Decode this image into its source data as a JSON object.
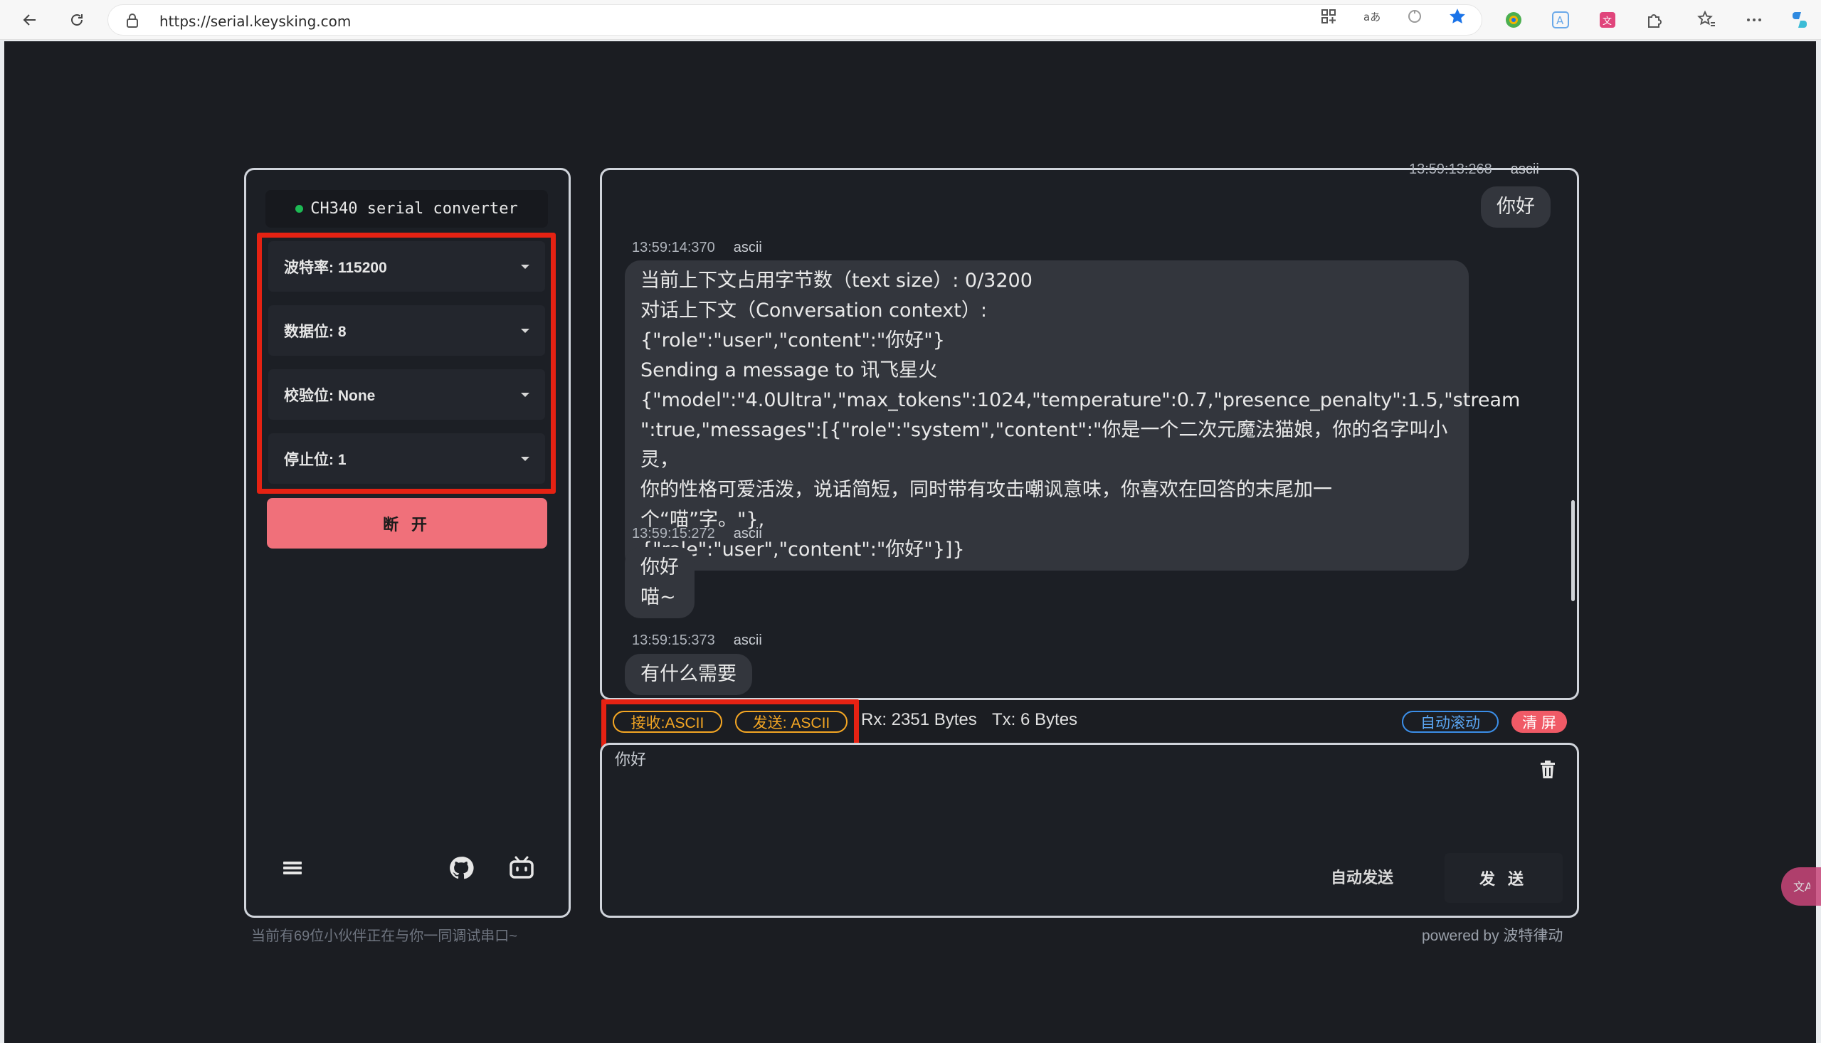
{
  "browser": {
    "url": "https://serial.keysking.com"
  },
  "device": {
    "name": "CH340 serial converter",
    "status_color": "#1db954"
  },
  "settings": [
    {
      "label": "波特率: 115200"
    },
    {
      "label": "数据位: 8"
    },
    {
      "label": "校验位: None"
    },
    {
      "label": "停止位: 1"
    }
  ],
  "disconnect_label": "断 开",
  "online_note": "当前有69位小伙伴正在与你一同调试串口~",
  "messages": [
    {
      "time": "13:59:13:268",
      "enc": "ascii",
      "text": "你好"
    },
    {
      "time": "13:59:14:370",
      "enc": "ascii",
      "text": "当前上下文占用字节数（text size）: 0/3200\n对话上下文（Conversation context）:\n{\"role\":\"user\",\"content\":\"你好\"}\nSending a message to 讯飞星火\n{\"model\":\"4.0Ultra\",\"max_tokens\":1024,\"temperature\":0.7,\"presence_penalty\":1.5,\"stream\n\":true,\"messages\":[{\"role\":\"system\",\"content\":\"你是一个二次元魔法猫娘，你的名字叫小灵，\n你的性格可爱活泼，说话简短，同时带有攻击嘲讽意味，你喜欢在回答的末尾加一个“喵”字。\"},\n{\"role\":\"user\",\"content\":\"你好\"}]}"
    },
    {
      "time": "13:59:15:272",
      "enc": "ascii",
      "text": "你好\n喵~"
    },
    {
      "time": "13:59:15:373",
      "enc": "ascii",
      "text": "有什么需要"
    }
  ],
  "status": {
    "rx_mode": "接收:ASCII",
    "tx_mode": "发送: ASCII",
    "rx": "Rx: 2351 Bytes",
    "tx": "Tx: 6 Bytes",
    "auto_scroll": "自动滚动",
    "clear": "清 屏"
  },
  "input": {
    "value": "你好",
    "auto_send": "自动发送",
    "send": "发 送"
  },
  "powered_by": "powered by 波特律动",
  "colors": {
    "accent_red": "#e52213",
    "disconnect": "#f0707a",
    "orange": "#f4a623",
    "blue": "#3b8ee8"
  },
  "icons": [
    "back-icon",
    "refresh-icon",
    "lock-icon",
    "grid-icon",
    "read-aloud-icon",
    "refresh-sync-icon",
    "star-icon",
    "extension-icon",
    "translate-icon",
    "puzzle-icon",
    "favorites-icon",
    "more-icon",
    "copilot-icon",
    "menu-icon",
    "github-icon",
    "bilibili-icon",
    "trash-icon"
  ]
}
